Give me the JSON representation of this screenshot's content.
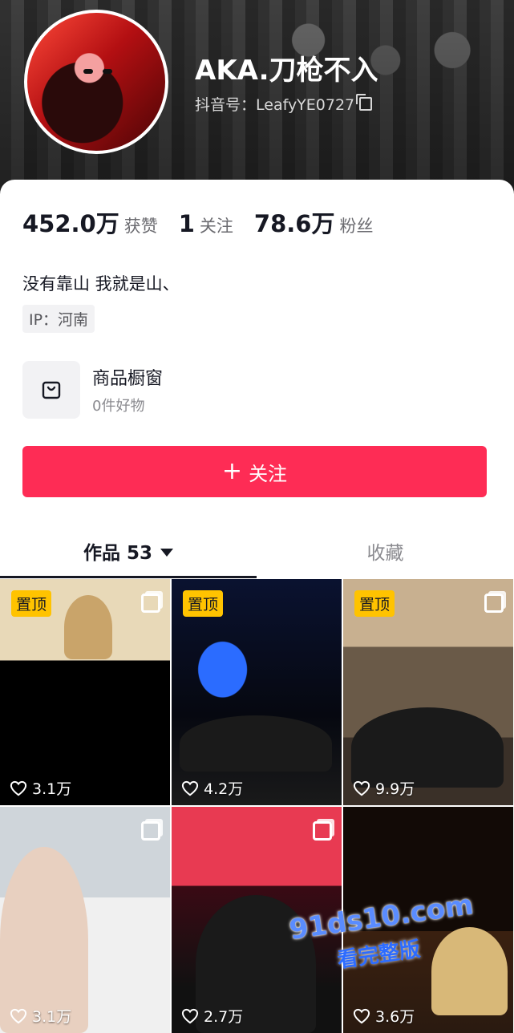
{
  "profile": {
    "nickname": "AKA.刀枪不入",
    "douyin_id": "抖音号：LeafyYE0727"
  },
  "stats": [
    {
      "value": "452.0万",
      "label": "获赞"
    },
    {
      "value": "1",
      "label": "关注"
    },
    {
      "value": "78.6万",
      "label": "粉丝"
    }
  ],
  "bio": "没有靠山 我就是山、",
  "ip": "IP：河南",
  "shop": {
    "title": "商品橱窗",
    "subtitle": "0件好物"
  },
  "follow": {
    "label": "关注"
  },
  "tabs": {
    "works": "作品 53",
    "favorites": "收藏"
  },
  "videos": [
    {
      "pinned": "置顶",
      "likes": "3.1万"
    },
    {
      "pinned": "置顶",
      "likes": "4.2万"
    },
    {
      "pinned": "置顶",
      "likes": "9.9万"
    },
    {
      "pinned": "",
      "likes": "3.1万"
    },
    {
      "pinned": "",
      "likes": "2.7万"
    },
    {
      "pinned": "",
      "likes": "3.6万"
    }
  ],
  "watermark": {
    "site": "91ds10.com",
    "text": "看完整版"
  },
  "colors": {
    "accent": "#fe2c55",
    "pin": "#ffc300"
  }
}
